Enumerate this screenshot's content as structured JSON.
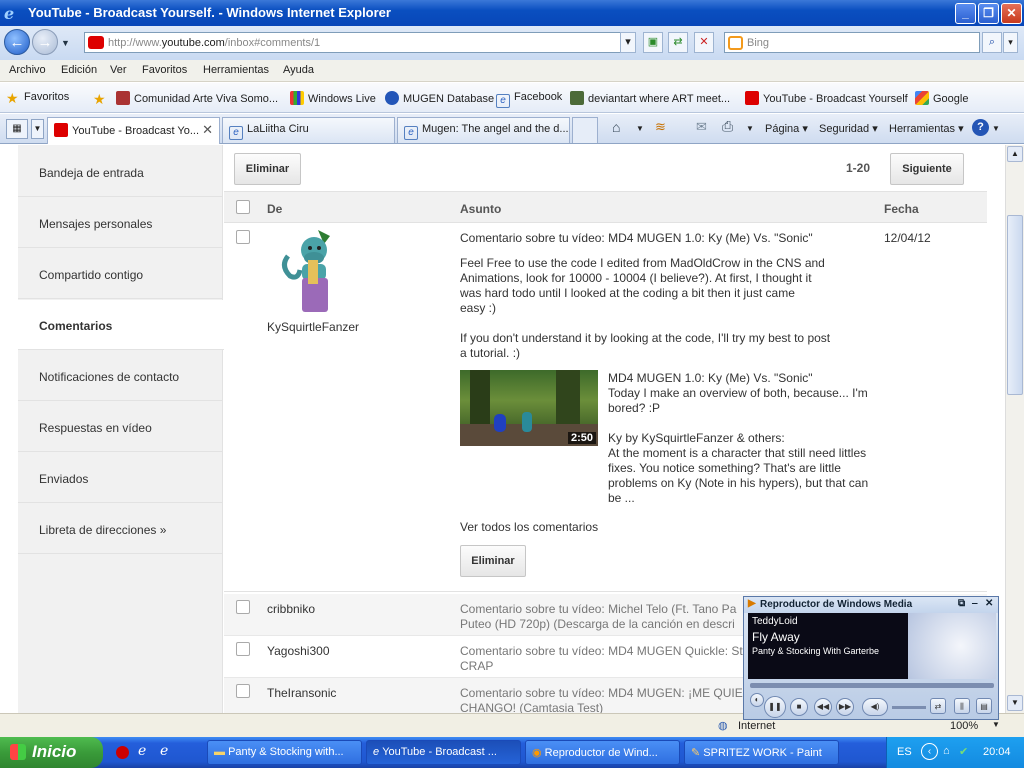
{
  "window": {
    "title": "YouTube - Broadcast Yourself. - Windows Internet Explorer"
  },
  "address": {
    "url_prefix": "http://www.",
    "url_domain": "youtube.com",
    "url_path": "/inbox#comments/1",
    "search_placeholder": "Bing"
  },
  "menu": [
    "Archivo",
    "Edición",
    "Ver",
    "Favoritos",
    "Herramientas",
    "Ayuda"
  ],
  "favorites": {
    "label": "Favoritos",
    "items": [
      "Comunidad Arte Viva  Somo...",
      "Windows Live",
      "MUGEN Database",
      "Facebook",
      "deviantart where ART meet...",
      "YouTube - Broadcast Yourself",
      "Google"
    ]
  },
  "tabs": [
    "YouTube - Broadcast Yo...",
    "LaLiitha Ciru",
    "Mugen: The angel and the d..."
  ],
  "tab_tools": [
    "Página",
    "Seguridad",
    "Herramientas"
  ],
  "sidebar": [
    "Bandeja de entrada",
    "Mensajes personales",
    "Compartido contigo",
    "Comentarios",
    "Notificaciones de contacto",
    "Respuestas en vídeo",
    "Enviados",
    "Libreta de direcciones »"
  ],
  "toolbar": {
    "delete": "Eliminar",
    "range": "1-20",
    "next": "Siguiente"
  },
  "columns": {
    "from": "De",
    "subject": "Asunto",
    "date": "Fecha"
  },
  "message": {
    "sender": "KySquirtleFanzer",
    "subject": "Comentario sobre tu vídeo: MD4 MUGEN 1.0: Ky (Me) Vs. \"Sonic\"",
    "date": "12/04/12",
    "body_lines_1": [
      "Feel Free to use the code I edited from MadOldCrow in the CNS and",
      "Animations, look for 10000 - 10004 (I believe?). At first, I thought it",
      "was hard todo until I looked at the coding a bit then it just came",
      "easy :)"
    ],
    "body_lines_2": [
      "If you don't understand it by looking at the code, I'll try my best to post",
      "a tutorial. :)"
    ],
    "video": {
      "duration": "2:50",
      "lines": [
        "MD4 MUGEN 1.0: Ky (Me) Vs. \"Sonic\"",
        "Today I make an overview of both, because... I'm",
        "bored? :P",
        "",
        "Ky by KySquirtleFanzer & others:",
        "At the moment is a character that still need littles",
        "fixes. You notice something? That's are little",
        "problems on Ky (Note in his hypers), but that can",
        "be ..."
      ]
    },
    "view_all": "Ver todos los comentarios",
    "delete": "Eliminar"
  },
  "rows": [
    {
      "from": "cribbniko",
      "subject_lines": [
        "Comentario sobre tu vídeo: Michel Telo (Ft. Tano Pa",
        "Puteo (HD 720p) (Descarga de la canción en descri"
      ]
    },
    {
      "from": "Yagoshi300",
      "subject_lines": [
        "Comentario sobre tu vídeo: MD4 MUGEN Quickle: St",
        "CRAP"
      ]
    },
    {
      "from": "TheIransonic",
      "subject_lines": [
        "Comentario sobre tu vídeo: MD4 MUGEN: ¡ME QUIEI",
        "CHANGO! (Camtasia Test)"
      ]
    }
  ],
  "status": {
    "zone": "Internet",
    "zoom": "100%"
  },
  "media_player": {
    "title": "Reproductor de Windows Media",
    "artist": "TeddyLoid",
    "track": "Fly Away",
    "album": "Panty & Stocking With Garterbe"
  },
  "taskbar": {
    "start": "Inicio",
    "tasks": [
      "Panty & Stocking with...",
      "YouTube - Broadcast ...",
      "Reproductor de Wind...",
      "SPRITEZ WORK - Paint"
    ],
    "lang": "ES",
    "clock": "20:04"
  },
  "colors": {
    "title_bar": "#0a4fc0",
    "youtube_red": "#dd0000",
    "taskbar": "#245edb",
    "start_green": "#3a9b3a"
  }
}
